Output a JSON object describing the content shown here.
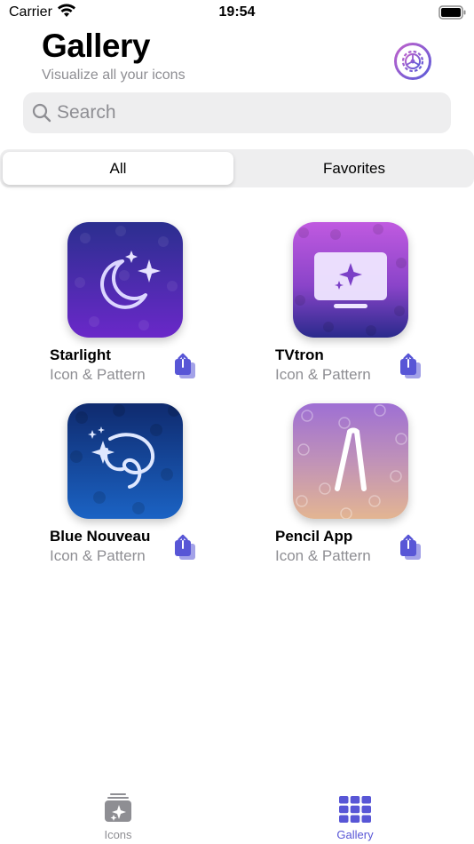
{
  "status_bar": {
    "carrier": "Carrier",
    "time": "19:54"
  },
  "header": {
    "title": "Gallery",
    "subtitle": "Visualize all your icons",
    "settings_icon": "settings-gear-icon"
  },
  "search": {
    "placeholder": "Search",
    "value": ""
  },
  "segments": [
    {
      "label": "All",
      "selected": true
    },
    {
      "label": "Favorites",
      "selected": false
    }
  ],
  "cards": [
    {
      "title": "Starlight",
      "subtitle": "Icon & Pattern",
      "icon": "moon-stars-icon"
    },
    {
      "title": "TVtron",
      "subtitle": "Icon & Pattern",
      "icon": "tv-sparkle-icon"
    },
    {
      "title": "Blue Nouveau",
      "subtitle": "Icon & Pattern",
      "icon": "sparkle-swirl-icon"
    },
    {
      "title": "Pencil App",
      "subtitle": "Icon & Pattern",
      "icon": "pencil-a-icon"
    }
  ],
  "tab_bar": [
    {
      "label": "Icons",
      "selected": false
    },
    {
      "label": "Gallery",
      "selected": true
    }
  ],
  "colors": {
    "accent": "#5856d6",
    "inactive_tab": "#8e8e93",
    "starlight_top": "#2b2f8f",
    "starlight_bottom": "#6a28c9",
    "tvtron_top": "#c05ae0",
    "tvtron_bottom": "#2a2a8c",
    "blue_nouveau_top": "#0f2a6e",
    "blue_nouveau_bottom": "#1b63c4",
    "pencil_top": "#9e6fd4",
    "pencil_bottom": "#e3b592"
  }
}
